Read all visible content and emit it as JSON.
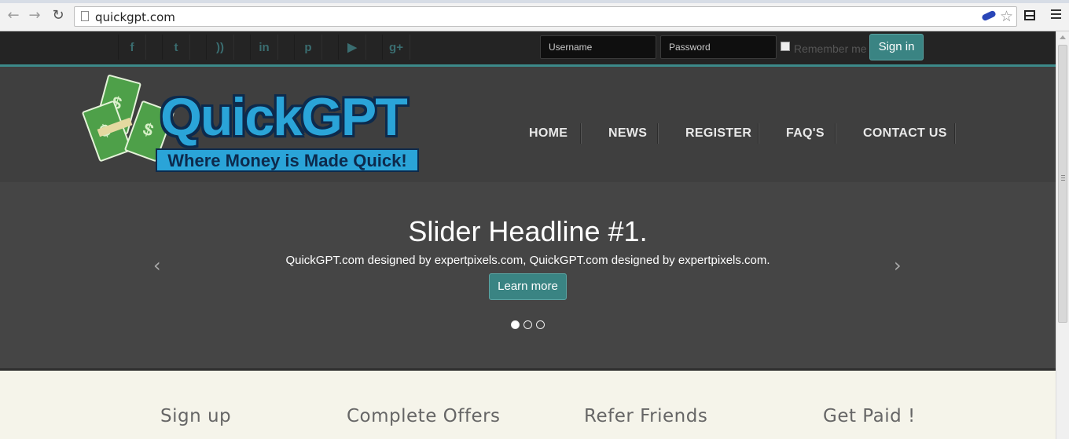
{
  "browser": {
    "url": "quickgpt.com"
  },
  "topbar": {
    "social_icons": [
      {
        "icon": "facebook-icon",
        "glyph": "f"
      },
      {
        "icon": "twitter-icon",
        "glyph": "t"
      },
      {
        "icon": "rss-icon",
        "glyph": "))"
      },
      {
        "icon": "linkedin-icon",
        "glyph": "in"
      },
      {
        "icon": "pinterest-icon",
        "glyph": "p"
      },
      {
        "icon": "youtube-icon",
        "glyph": "▶"
      },
      {
        "icon": "googleplus-icon",
        "glyph": "g+"
      }
    ],
    "username_placeholder": "Username",
    "password_placeholder": "Password",
    "remember_label": "Remember me",
    "signin_label": "Sign in"
  },
  "logo": {
    "word": "QuickGPT",
    "tagline": "Where Money is Made Quick!"
  },
  "nav": {
    "items": [
      "HOME",
      "NEWS",
      "REGISTER",
      "FAQ'S",
      "CONTACT US"
    ]
  },
  "slider": {
    "headline": "Slider Headline #1.",
    "text": "QuickGPT.com designed by expertpixels.com, QuickGPT.com designed by expertpixels.com.",
    "button_label": "Learn more",
    "prev": "‹",
    "next": "›",
    "slide_count": 3,
    "active_slide": 1
  },
  "steps": [
    "Sign up",
    "Complete Offers",
    "Refer Friends",
    "Get Paid !"
  ],
  "colors": {
    "accent": "#3a8483",
    "topbar_bg": "#242424",
    "header_bg": "#3f3f3f",
    "slider_bg": "#454545",
    "page_bg": "#f5f4ea",
    "logo_blue": "#2aa4d8"
  }
}
